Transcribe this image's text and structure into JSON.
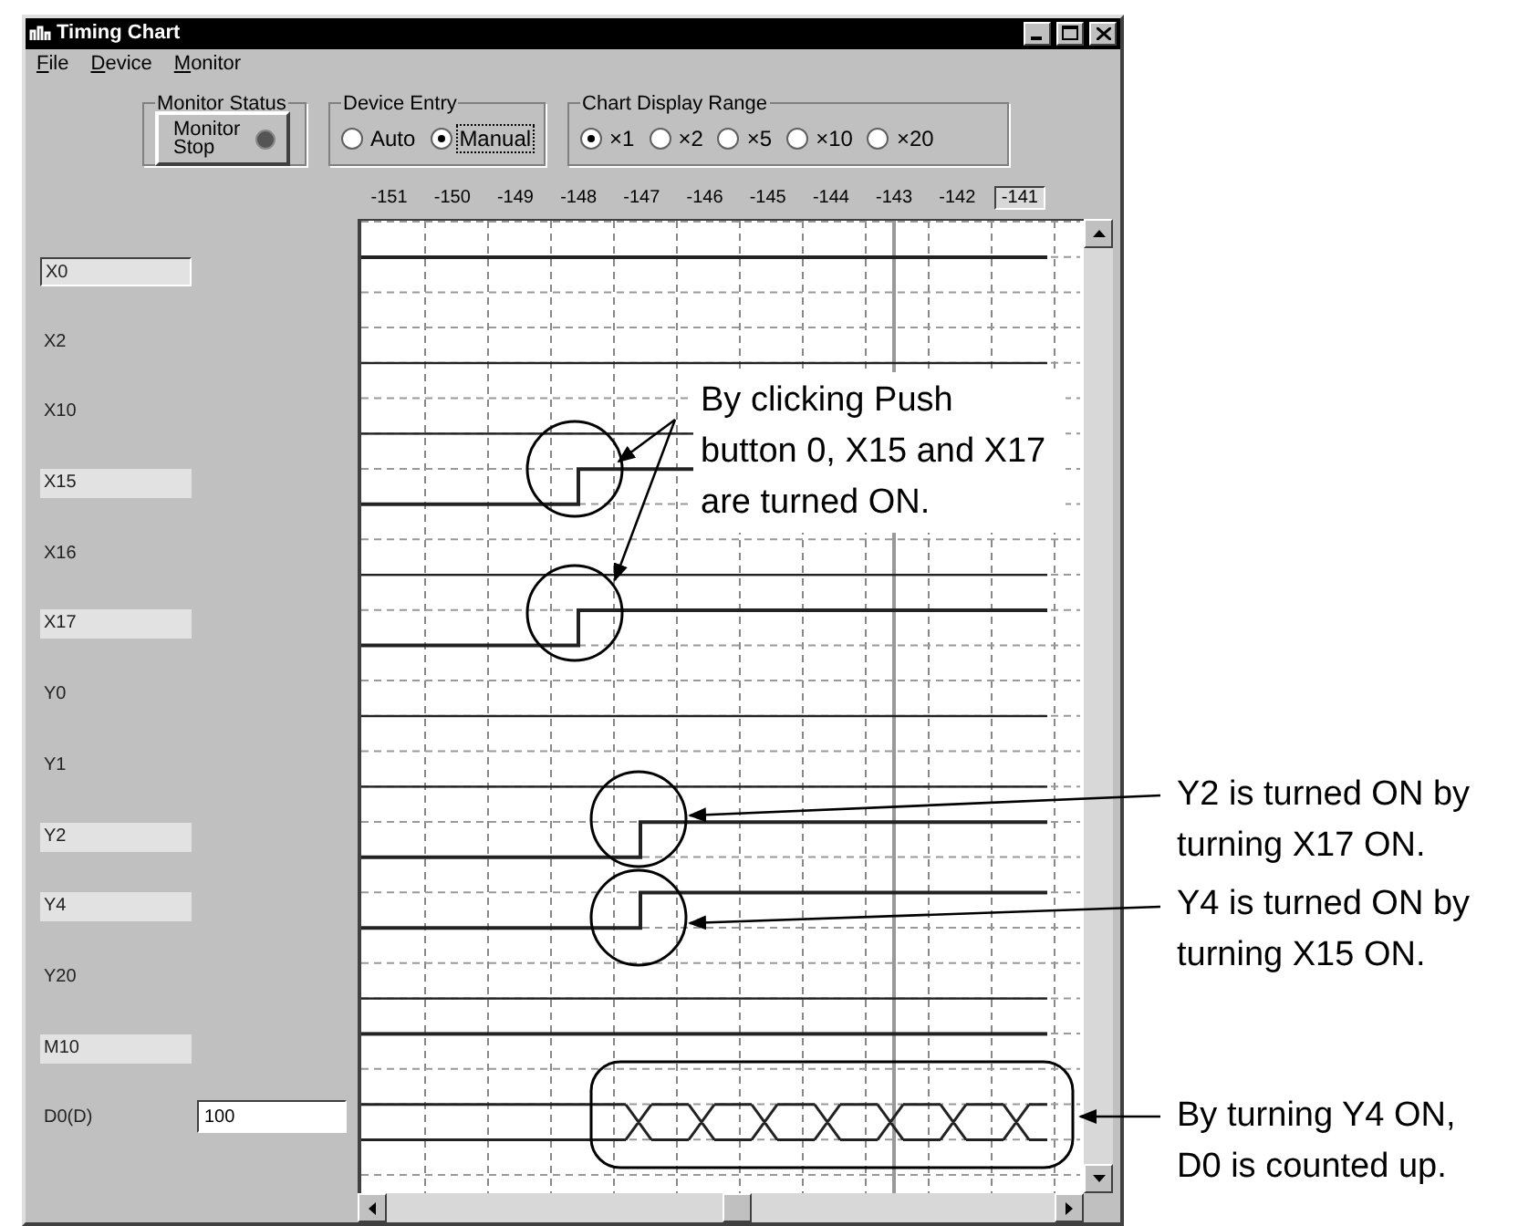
{
  "window": {
    "title": "Timing Chart"
  },
  "menu": [
    "File",
    "Device",
    "Monitor"
  ],
  "monitor_status": {
    "label": "Monitor Status",
    "button": "Monitor Stop",
    "lamp_on": false
  },
  "device_entry": {
    "label": "Device Entry",
    "options": [
      {
        "label": "Auto",
        "selected": false
      },
      {
        "label": "Manual",
        "selected": true
      }
    ]
  },
  "display_range": {
    "label": "Chart Display Range",
    "options": [
      {
        "label": "×1",
        "selected": true
      },
      {
        "label": "×2",
        "selected": false
      },
      {
        "label": "×5",
        "selected": false
      },
      {
        "label": "×10",
        "selected": false
      },
      {
        "label": "×20",
        "selected": false
      }
    ]
  },
  "ticks": [
    {
      "label": "-151",
      "current": false
    },
    {
      "label": "-150",
      "current": false
    },
    {
      "label": "-149",
      "current": false
    },
    {
      "label": "-148",
      "current": false
    },
    {
      "label": "-147",
      "current": false
    },
    {
      "label": "-146",
      "current": false
    },
    {
      "label": "-145",
      "current": false
    },
    {
      "label": "-144",
      "current": false
    },
    {
      "label": "-143",
      "current": false
    },
    {
      "label": "-142",
      "current": false
    },
    {
      "label": "-141",
      "current": true
    }
  ],
  "devices": [
    {
      "name": "X0",
      "kind": "bit",
      "on": true,
      "edge": false,
      "selected": true
    },
    {
      "name": "X2",
      "kind": "bit",
      "on": false,
      "edge": false,
      "selected": false
    },
    {
      "name": "X10",
      "kind": "bit",
      "on": false,
      "edge": false,
      "selected": false
    },
    {
      "name": "X15",
      "kind": "bit",
      "on": true,
      "edge": true,
      "selected": false
    },
    {
      "name": "X16",
      "kind": "bit",
      "on": false,
      "edge": false,
      "selected": false
    },
    {
      "name": "X17",
      "kind": "bit",
      "on": true,
      "edge": true,
      "selected": false
    },
    {
      "name": "Y0",
      "kind": "bit",
      "on": false,
      "edge": false,
      "selected": false
    },
    {
      "name": "Y1",
      "kind": "bit",
      "on": false,
      "edge": false,
      "selected": false
    },
    {
      "name": "Y2",
      "kind": "bit",
      "on": true,
      "edge": true,
      "selected": false
    },
    {
      "name": "Y4",
      "kind": "bit",
      "on": true,
      "edge": true,
      "selected": false
    },
    {
      "name": "Y20",
      "kind": "bit",
      "on": false,
      "edge": false,
      "selected": false
    },
    {
      "name": "M10",
      "kind": "bit",
      "on": true,
      "edge": false,
      "selected": false
    },
    {
      "name": "D0(D)",
      "kind": "word",
      "value": "100",
      "selected": false
    }
  ],
  "callouts": [
    "By clicking Push button 0, X15 and X17 are turned ON.",
    "Y2 is turned ON by turning X17 ON.",
    "Y4 is turned ON by turning X15 ON.",
    "By turning Y4 ON, D0 is counted up."
  ]
}
